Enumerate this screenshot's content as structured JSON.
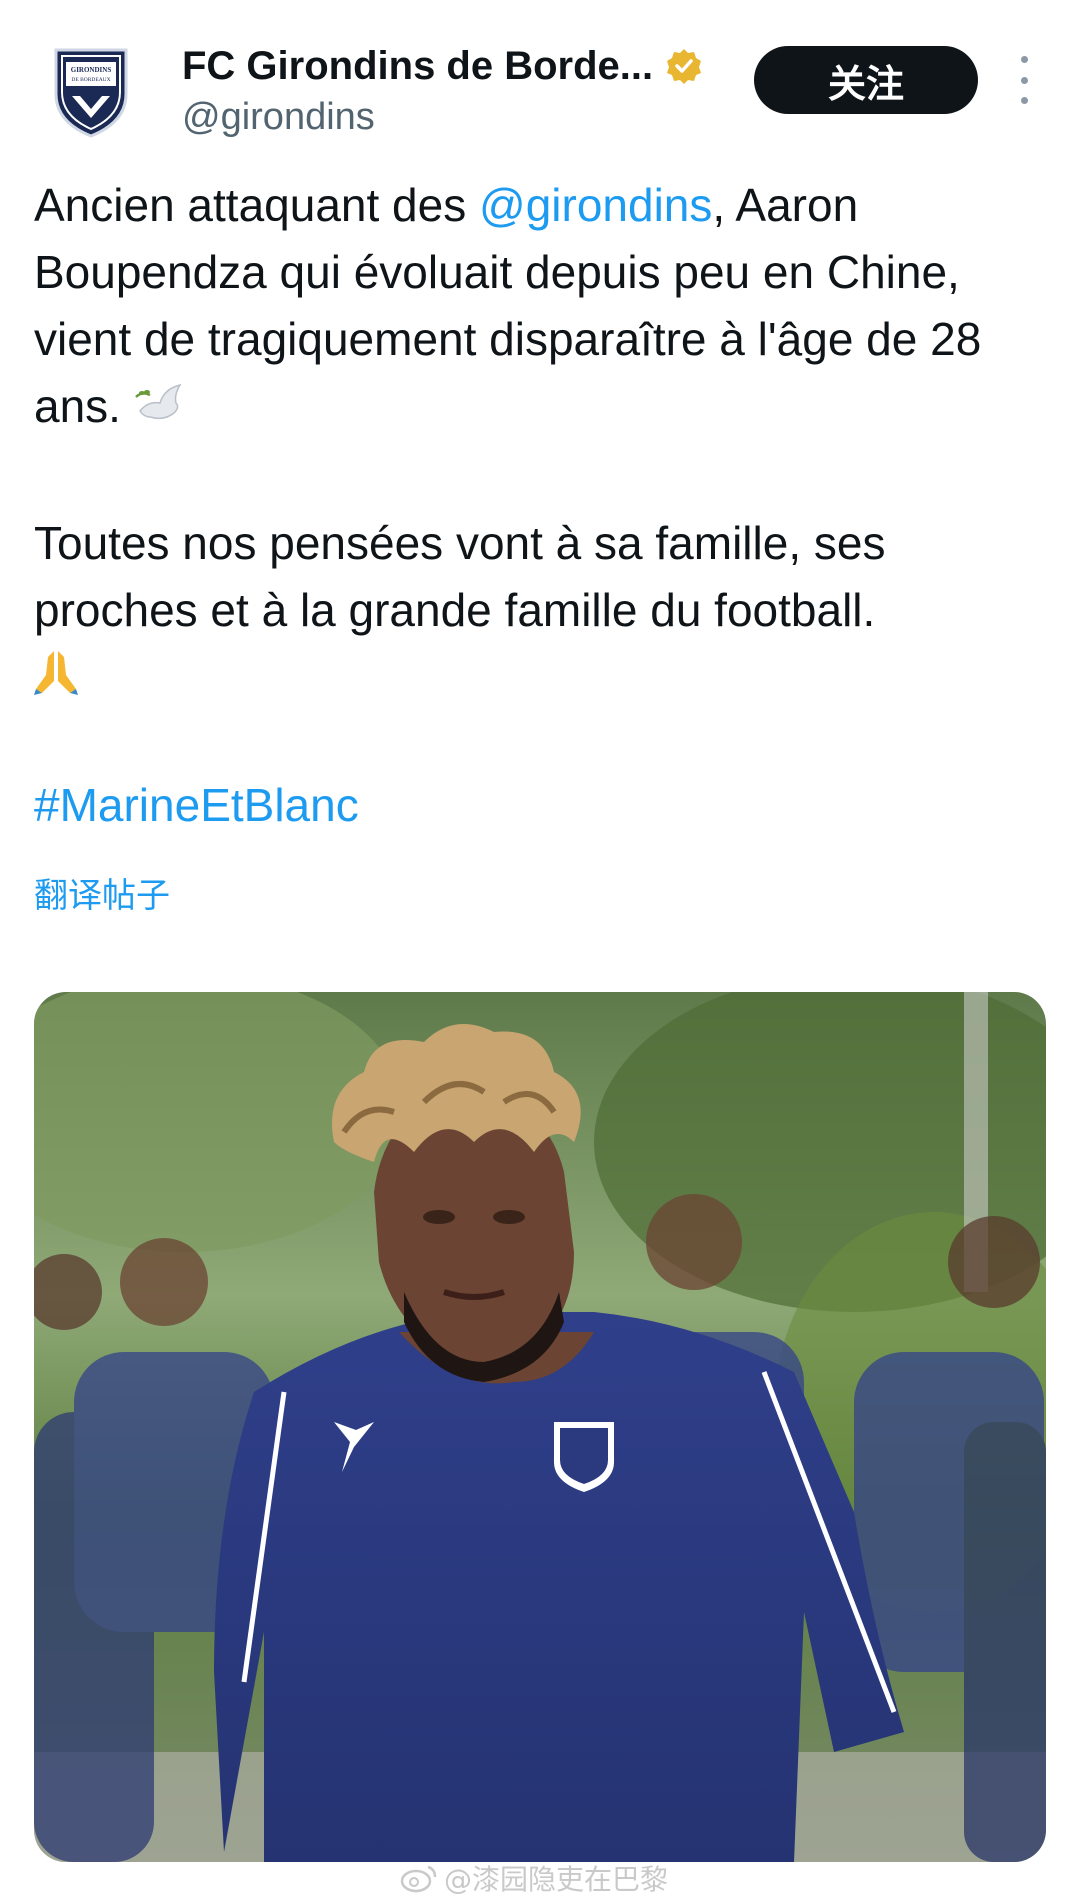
{
  "account": {
    "name": "FC Girondins de Borde...",
    "handle": "@girondins",
    "avatar_text": "GIRONDINS DE BORDEAUX",
    "verified_icon": "verified-badge-gold"
  },
  "actions": {
    "follow_label": "关注",
    "more_icon": "more-vertical-icon"
  },
  "post": {
    "p1_before": "Ancien attaquant des ",
    "p1_mention": "@girondins",
    "p1_after": ", Aaron Boupendza qui évoluait depuis peu en Chine, vient de tragiquement disparaître à l'âge de 28 ans.",
    "p1_emoji": "dove-icon",
    "p2_text": "Toutes nos pensées vont à sa famille, ses proches et à la grande famille du football.",
    "p2_emoji": "praying-hands-icon",
    "hashtag": "#MarineEtBlanc",
    "translate_label": "翻译帖子"
  },
  "media": {
    "alt": "photo"
  },
  "watermark": {
    "text": "@漆园隐吏在巴黎"
  }
}
